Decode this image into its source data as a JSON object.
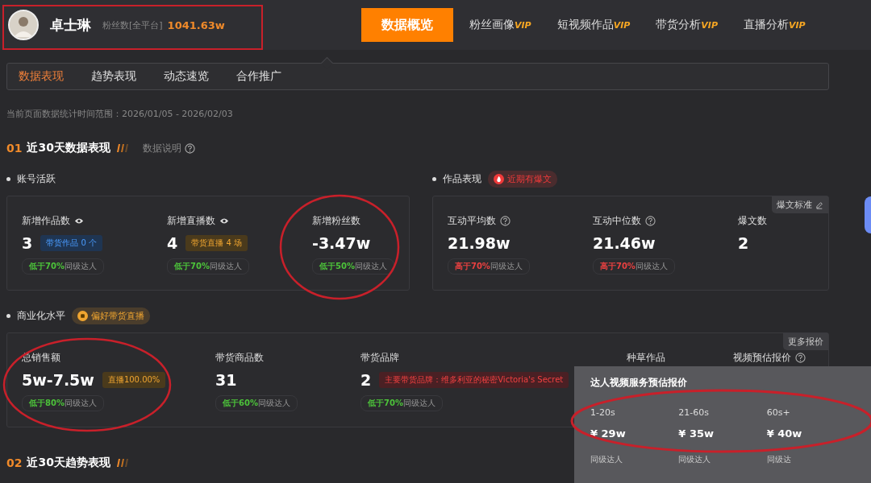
{
  "profile": {
    "name": "卓士琳",
    "fans_label": "粉丝数[全平台]",
    "fans_value": "1041.63w"
  },
  "nav": [
    {
      "label": "数据概览",
      "selected": true
    },
    {
      "label": "粉丝画像",
      "badge": "VIP",
      "selected": false
    },
    {
      "label": "短视频作品",
      "badge": "VIP",
      "selected": false
    },
    {
      "label": "带货分析",
      "badge": "VIP",
      "selected": false
    },
    {
      "label": "直播分析",
      "badge": "VIP",
      "selected": false
    }
  ],
  "subtabs": [
    {
      "label": "数据表现",
      "selected": true
    },
    {
      "label": "趋势表现",
      "selected": false
    },
    {
      "label": "动态速览",
      "selected": false
    },
    {
      "label": "合作推广",
      "selected": false
    }
  ],
  "date_range": "当前页面数据统计时间范围：2026/01/05 - 2026/02/03",
  "section1": {
    "number": "01",
    "title": "近30天数据表现",
    "help_link": "数据说明"
  },
  "account_activity": {
    "title": "账号活跃",
    "metrics": [
      {
        "label": "新增作品数",
        "value": "3",
        "tag": {
          "text": "带货作品 0 个",
          "kind": "info"
        },
        "compare": {
          "kind": "lower",
          "highlight": "低于70%",
          "rest": "同级达人"
        }
      },
      {
        "label": "新增直播数",
        "value": "4",
        "tag": {
          "text": "带货直播 4 场",
          "kind": "warning"
        },
        "compare": {
          "kind": "lower",
          "highlight": "低于70%",
          "rest": "同级达人"
        }
      },
      {
        "label": "新增粉丝数",
        "value": "-3.47w",
        "compare": {
          "kind": "lower",
          "highlight": "低于50%",
          "rest": "同级达人"
        }
      }
    ]
  },
  "works": {
    "title": "作品表现",
    "badge": {
      "text": "近期有爆文",
      "color": "#f03a3a"
    },
    "corner_button": "爆文标准",
    "metrics": [
      {
        "label": "互动平均数",
        "value": "21.98w",
        "compare": {
          "kind": "higher",
          "highlight": "高于70%",
          "rest": "同级达人"
        }
      },
      {
        "label": "互动中位数",
        "value": "21.46w",
        "compare": {
          "kind": "higher",
          "highlight": "高于70%",
          "rest": "同级达人"
        }
      },
      {
        "label": "爆文数",
        "value": "2"
      }
    ]
  },
  "commerce": {
    "title": "商业化水平",
    "badge": {
      "text": "偏好带货直播",
      "color": "#f0a530"
    },
    "corner_button": "更多报价",
    "metrics": [
      {
        "label": "总销售额",
        "value": "5w-7.5w",
        "tag": {
          "text": "直播100.00%",
          "kind": "warning"
        },
        "compare": {
          "kind": "lower",
          "highlight": "低于80%",
          "rest": "同级达人"
        }
      },
      {
        "label": "带货商品数",
        "value": "31",
        "compare": {
          "kind": "lower",
          "highlight": "低于60%",
          "rest": "同级达人"
        }
      },
      {
        "label": "带货品牌",
        "value": "2",
        "tag": {
          "text": "主要带货品牌：维多利亚的秘密Victoria's Secret",
          "kind": "danger"
        },
        "compare": {
          "kind": "lower",
          "highlight": "低于70%",
          "rest": "同级达人"
        }
      },
      {
        "label": "种草作品"
      },
      {
        "label": "视频预估报价"
      }
    ]
  },
  "price_popup": {
    "title": "达人视频服务预估报价",
    "prices": [
      {
        "duration": "1-20s",
        "price": "¥ 29w",
        "rest": "同级达人"
      },
      {
        "duration": "21-60s",
        "price": "¥ 35w",
        "rest": "同级达人"
      },
      {
        "duration": "60s+",
        "price": "¥ 40w",
        "rest": "同级达"
      }
    ]
  },
  "section2": {
    "number": "02",
    "title": "近30天趋势表现"
  }
}
